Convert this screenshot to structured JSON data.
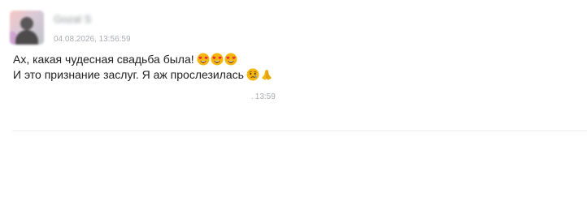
{
  "sender": {
    "name": "Gozal S",
    "timestamp": "04.08.2026, 13:56:59"
  },
  "message": {
    "line1": "Ах, какая чудесная свадьба была!",
    "line1_emojis": [
      "heart-eyes-icon",
      "heart-eyes-icon",
      "heart-eyes-icon"
    ],
    "line2": "И это признание заслуг. Я аж прослезилась",
    "line2_emojis": [
      "crying-face-icon",
      "folded-hands-icon"
    ],
    "sent_time": "13:59"
  },
  "colors": {
    "emoji_yellow": "#f5b50f",
    "heart_red": "#e52d3c",
    "divider": "#ececec"
  }
}
